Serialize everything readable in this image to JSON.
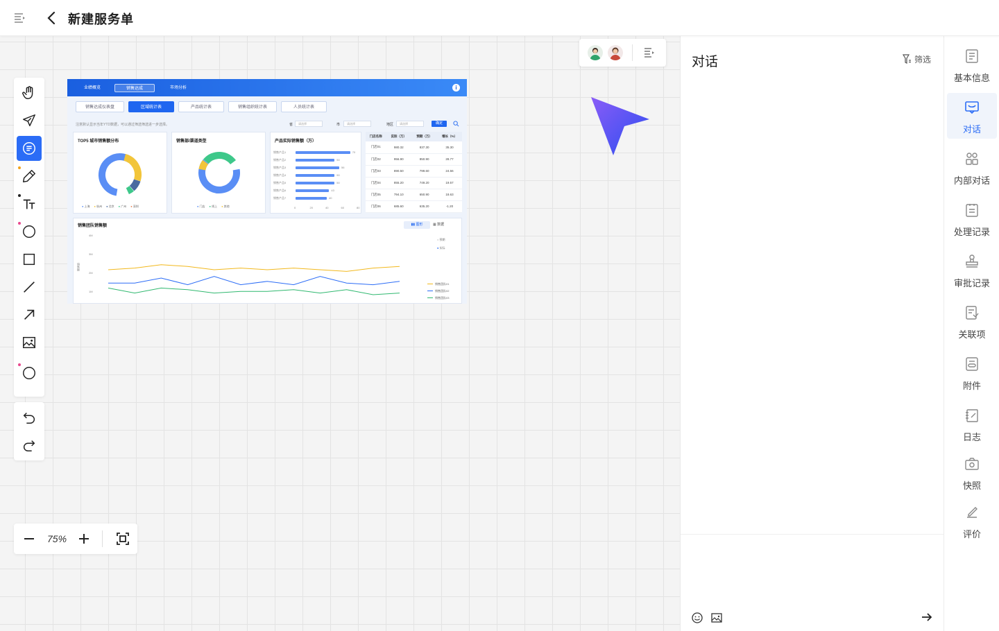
{
  "header": {
    "title": "新建服务单"
  },
  "zoom": {
    "value": "75%"
  },
  "panel": {
    "title": "对话",
    "filter_label": "筛选"
  },
  "sidenav": {
    "items": [
      {
        "label": "基本信息",
        "icon": "document-icon"
      },
      {
        "label": "对话",
        "icon": "chat-icon"
      },
      {
        "label": "内部对话",
        "icon": "team-icon"
      },
      {
        "label": "处理记录",
        "icon": "record-icon"
      },
      {
        "label": "审批记录",
        "icon": "stamp-icon"
      },
      {
        "label": "关联项",
        "icon": "link-list-icon"
      },
      {
        "label": "附件",
        "icon": "attachment-icon"
      },
      {
        "label": "日志",
        "icon": "log-icon"
      },
      {
        "label": "快照",
        "icon": "camera-icon"
      },
      {
        "label": "评价",
        "icon": "rate-icon"
      }
    ]
  },
  "colors": {
    "accent": "#2b6cf6",
    "dash_top": "#1a5fe0"
  },
  "dashboard": {
    "tabs": [
      "业绩概览",
      "销售达成",
      "市场分析"
    ],
    "subtabs": [
      "销售达成仪表盘",
      "区域统计表",
      "产品统计表",
      "销售组织统计表",
      "人员统计表"
    ],
    "note": "注意默认显示当年YTD数据，可以通过筛选筛选进一步选择。",
    "filters": {
      "province": "省",
      "city": "市",
      "region": "地区",
      "placeholder": "请选择",
      "confirm": "确定"
    },
    "card1": {
      "title": "TOP5 城市销售额分布",
      "legend": [
        "上海",
        "杭州",
        "北京",
        "广州",
        "深圳"
      ]
    },
    "card2": {
      "title": "销售部/渠道类型",
      "legend": [
        "门店",
        "线上",
        "其他"
      ]
    },
    "card3": {
      "title": "产品实际销售额（万）"
    },
    "bars": {
      "labels": [
        "销售产品1",
        "销售产品2",
        "销售产品3",
        "销售产品4",
        "销售产品5",
        "销售产品6",
        "销售产品7"
      ],
      "values": [
        70,
        50,
        56,
        50,
        50,
        43,
        40
      ],
      "ticks": [
        "0",
        "20",
        "40",
        "60",
        "80"
      ]
    },
    "table": {
      "headers": [
        "门店名称",
        "实际（万）",
        "预期（万）",
        "增长（%）"
      ],
      "rows": [
        [
          "门店01",
          "980.32",
          "837.30",
          "35.30"
        ],
        [
          "门店02",
          "956.90",
          "850.90",
          "28.77"
        ],
        [
          "门店03",
          "890.50",
          "799.60",
          "24.56"
        ],
        [
          "门店04",
          "855.20",
          "749.20",
          "19.57"
        ],
        [
          "门店05",
          "794.10",
          "650.90",
          "18.63"
        ],
        [
          "门店06",
          "685.60",
          "635.20",
          "-1.20"
        ]
      ]
    },
    "line": {
      "title": "销售团队销售额",
      "toggle": [
        "图形",
        "数据"
      ],
      "radio": [
        "预期",
        "实际"
      ],
      "ylabel": "销售额",
      "yticks": [
        "4M",
        "3M",
        "2M",
        "1M"
      ],
      "series": [
        {
          "name": "销售团队01",
          "color": "#f2b81c",
          "values": [
            2.0,
            2.1,
            2.3,
            2.2,
            2.0,
            2.1,
            2.0,
            2.1,
            2.0,
            1.9,
            2.1,
            2.2
          ]
        },
        {
          "name": "销售团队02",
          "color": "#2b6cf6",
          "values": [
            1.2,
            1.2,
            1.5,
            1.1,
            1.6,
            1.1,
            1.3,
            1.1,
            1.6,
            1.2,
            1.1,
            1.3
          ]
        },
        {
          "name": "销售团队03",
          "color": "#2fb86f",
          "values": [
            0.9,
            0.6,
            0.9,
            0.8,
            0.6,
            0.7,
            0.7,
            0.8,
            0.6,
            0.8,
            0.5,
            0.6
          ]
        }
      ]
    }
  }
}
